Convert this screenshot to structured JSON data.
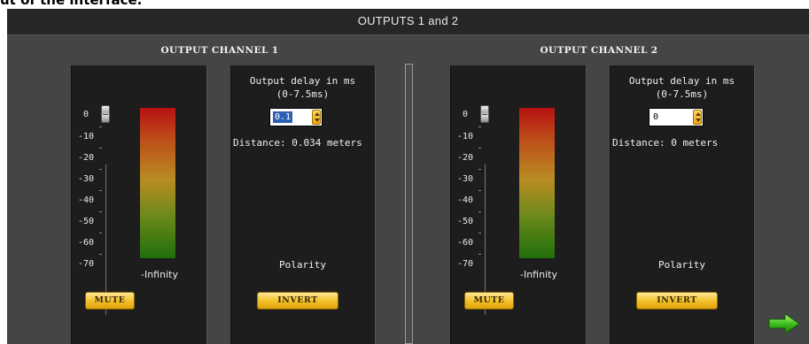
{
  "caption": "ut of the interface.",
  "window": {
    "title": "OUTPUTS 1 and 2"
  },
  "channels": [
    {
      "title": "OUTPUT CHANNEL 1",
      "scale": [
        "0",
        "-10",
        "-20",
        "-30",
        "-40",
        "-50",
        "-60",
        "-70"
      ],
      "level": "-Infinity",
      "mute_label": "MUTE",
      "delay_label_line1": "Output delay in ms",
      "delay_label_line2": "(0-7.5ms)",
      "delay_value": "0.1",
      "distance": "Distance: 0.034 meters",
      "polarity_label": "Polarity",
      "invert_label": "INVERT"
    },
    {
      "title": "OUTPUT CHANNEL 2",
      "scale": [
        "0",
        "-10",
        "-20",
        "-30",
        "-40",
        "-50",
        "-60",
        "-70"
      ],
      "level": "-Infinity",
      "mute_label": "MUTE",
      "delay_label_line1": "Output delay in ms",
      "delay_label_line2": "(0-7.5ms)",
      "delay_value": "0",
      "distance": "Distance: 0 meters",
      "polarity_label": "Polarity",
      "invert_label": "INVERT"
    }
  ],
  "icons": {
    "next": "arrow-right-icon"
  },
  "colors": {
    "accent": "#f4c22c",
    "next_arrow": "#3fbf1f",
    "panel": "#1d1d1d",
    "background": "#444546"
  }
}
